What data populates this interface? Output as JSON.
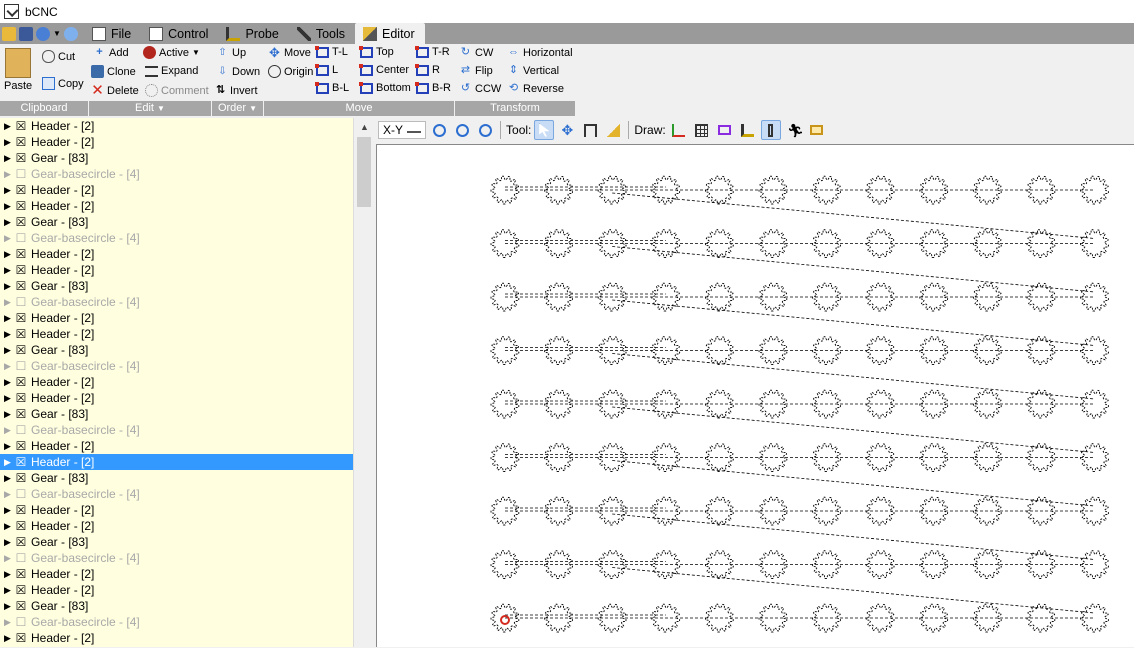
{
  "window": {
    "title": "bCNC"
  },
  "tabs": [
    {
      "label": "File",
      "icon": "file-icon"
    },
    {
      "label": "Control",
      "icon": "control-icon"
    },
    {
      "label": "Probe",
      "icon": "probe-icon"
    },
    {
      "label": "Tools",
      "icon": "tools-icon"
    },
    {
      "label": "Editor",
      "icon": "editor-icon",
      "active": true
    }
  ],
  "ribbon": {
    "clipboard": {
      "label": "Clipboard",
      "paste": "Paste",
      "cut": "Cut",
      "copy": "Copy"
    },
    "edit": {
      "label": "Edit",
      "add": "Add",
      "clone": "Clone",
      "delete": "Delete",
      "active": "Active",
      "expand": "Expand",
      "comment": "Comment"
    },
    "order": {
      "label": "Order",
      "up": "Up",
      "down": "Down",
      "invert": "Invert"
    },
    "move": {
      "label": "Move",
      "move": "Move",
      "origin": "Origin",
      "tl": "T-L",
      "l": "L",
      "bl": "B-L",
      "top": "Top",
      "center": "Center",
      "bottom": "Bottom",
      "tr": "T-R",
      "r": "R",
      "br": "B-R"
    },
    "transform": {
      "label": "Transform",
      "cw": "CW",
      "flip": "Flip",
      "ccw": "CCW",
      "horizontal": "Horizontal",
      "vertical": "Vertical",
      "reverse": "Reverse"
    }
  },
  "canvas_toolbar": {
    "view": "X-Y",
    "tool_label": "Tool:",
    "draw_label": "Draw:"
  },
  "tree": {
    "items": [
      {
        "label": "Header - [2]",
        "enabled": true
      },
      {
        "label": "Header - [2]",
        "enabled": true
      },
      {
        "label": "Gear - [83]",
        "enabled": true
      },
      {
        "label": "Gear-basecircle - [4]",
        "enabled": false
      },
      {
        "label": "Header - [2]",
        "enabled": true
      },
      {
        "label": "Header - [2]",
        "enabled": true
      },
      {
        "label": "Gear - [83]",
        "enabled": true
      },
      {
        "label": "Gear-basecircle - [4]",
        "enabled": false
      },
      {
        "label": "Header - [2]",
        "enabled": true
      },
      {
        "label": "Header - [2]",
        "enabled": true
      },
      {
        "label": "Gear - [83]",
        "enabled": true
      },
      {
        "label": "Gear-basecircle - [4]",
        "enabled": false
      },
      {
        "label": "Header - [2]",
        "enabled": true
      },
      {
        "label": "Header - [2]",
        "enabled": true
      },
      {
        "label": "Gear - [83]",
        "enabled": true
      },
      {
        "label": "Gear-basecircle - [4]",
        "enabled": false
      },
      {
        "label": "Header - [2]",
        "enabled": true
      },
      {
        "label": "Header - [2]",
        "enabled": true
      },
      {
        "label": "Gear - [83]",
        "enabled": true
      },
      {
        "label": "Gear-basecircle - [4]",
        "enabled": false
      },
      {
        "label": "Header - [2]",
        "enabled": true
      },
      {
        "label": "Header - [2]",
        "enabled": true,
        "selected": true
      },
      {
        "label": "Gear - [83]",
        "enabled": true
      },
      {
        "label": "Gear-basecircle - [4]",
        "enabled": false
      },
      {
        "label": "Header - [2]",
        "enabled": true
      },
      {
        "label": "Header - [2]",
        "enabled": true
      },
      {
        "label": "Gear - [83]",
        "enabled": true
      },
      {
        "label": "Gear-basecircle - [4]",
        "enabled": false
      },
      {
        "label": "Header - [2]",
        "enabled": true
      },
      {
        "label": "Header - [2]",
        "enabled": true
      },
      {
        "label": "Gear - [83]",
        "enabled": true
      },
      {
        "label": "Gear-basecircle - [4]",
        "enabled": false
      },
      {
        "label": "Header - [2]",
        "enabled": true
      }
    ]
  },
  "gear_grid": {
    "rows": 9,
    "cols": 12
  },
  "colors": {
    "selected_row": "#3399ff",
    "tree_bg": "#ffffe0",
    "tab_bar": "#9a9a9a",
    "group_label_bg": "#a6a6a6",
    "origin_marker": "#d42b1e"
  }
}
